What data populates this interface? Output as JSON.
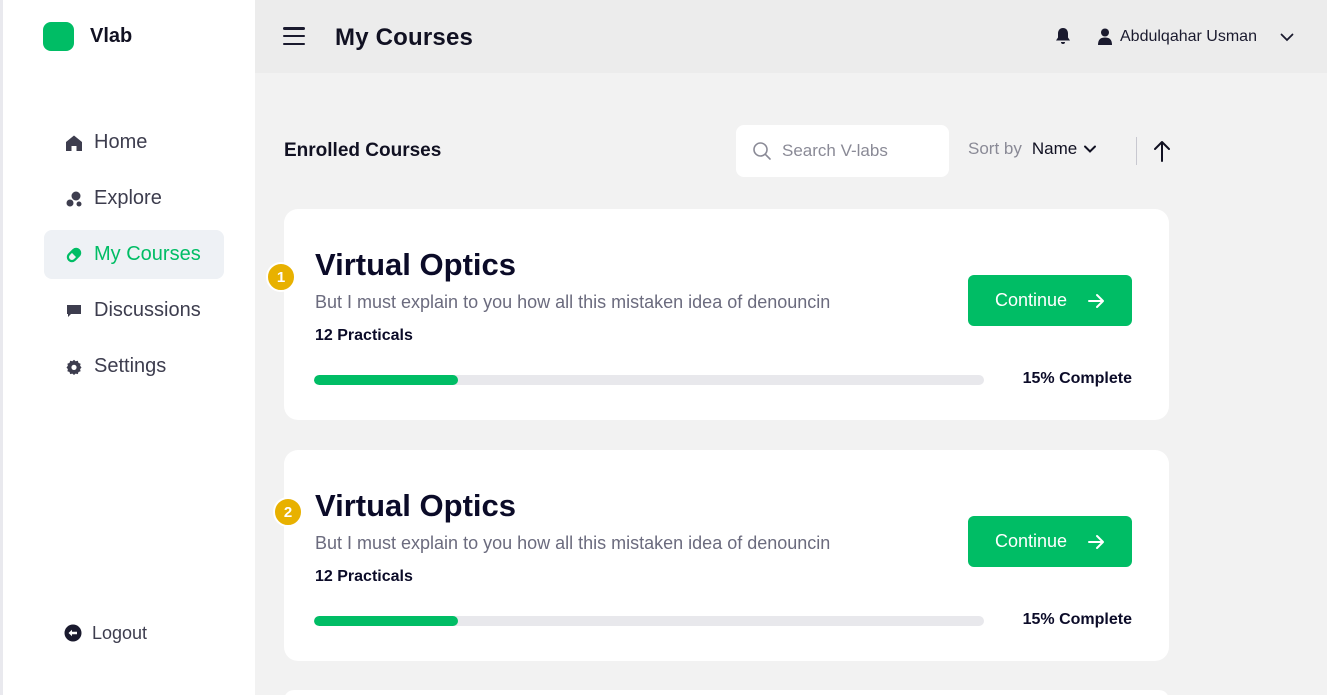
{
  "brand": {
    "name": "Vlab",
    "color": "#00bd65"
  },
  "sidebar": {
    "items": [
      {
        "label": "Home",
        "icon": "home-icon",
        "active": false
      },
      {
        "label": "Explore",
        "icon": "explore-icon",
        "active": false
      },
      {
        "label": "My Courses",
        "icon": "pill-icon",
        "active": true
      },
      {
        "label": "Discussions",
        "icon": "chat-icon",
        "active": false
      },
      {
        "label": "Settings",
        "icon": "gear-icon",
        "active": false
      }
    ],
    "logout_label": "Logout"
  },
  "header": {
    "title": "My Courses",
    "user_name": "Abdulqahar Usman"
  },
  "toolbar": {
    "section_title": "Enrolled Courses",
    "search_placeholder": "Search V-labs",
    "sort_label": "Sort by",
    "sort_value": "Name"
  },
  "courses": [
    {
      "number": "1",
      "title": "Virtual Optics",
      "description": "But I must explain to you how all this mistaken idea of denouncin",
      "practicals": "12 Practicals",
      "progress_percent": 15,
      "progress_label": "15% Complete",
      "button_label": "Continue"
    },
    {
      "number": "2",
      "title": "Virtual Optics",
      "description": "But I must explain to you how all this mistaken idea of denouncin",
      "practicals": "12 Practicals",
      "progress_percent": 15,
      "progress_label": "15% Complete",
      "button_label": "Continue"
    }
  ],
  "colors": {
    "accent": "#00bd65",
    "badge": "#e8b100",
    "progress_track": "#e8e8ec"
  }
}
